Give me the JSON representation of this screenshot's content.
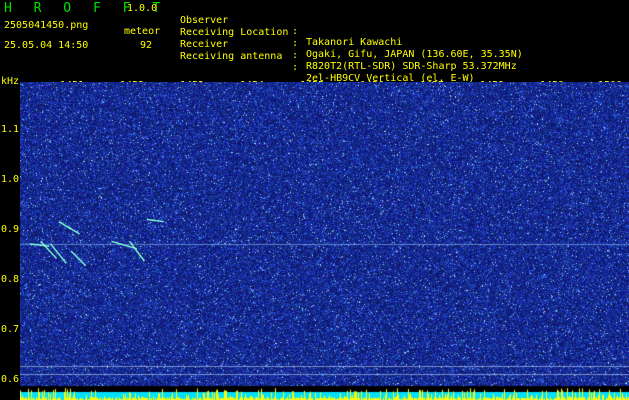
{
  "header": {
    "title": "H R O F F T",
    "version": "1.0.0",
    "file_name": "2505041450.png",
    "timestamp": "25.05.04 14:50",
    "mode": "meteor",
    "meteor_count": "92"
  },
  "metadata": [
    {
      "key": "Observer",
      "sep": ":",
      "value": "Takanori Kawachi"
    },
    {
      "key": "Receiving Location",
      "sep": ":",
      "value": "Ogaki, Gifu, JAPAN (136.60E, 35.35N)"
    },
    {
      "key": "Receiver",
      "sep": ":",
      "value": "R820T2(RTL-SDR) SDR-Sharp 53.372MHz"
    },
    {
      "key": "Receiving antenna",
      "sep": ":",
      "value": "2el-HB9CV Vertical (el. E-W)"
    }
  ],
  "axes": {
    "y_unit": "kHz",
    "x_ticks": [
      "1451",
      "1452",
      "1453",
      "1454",
      "1455",
      "1456",
      "1457",
      "1458",
      "1459",
      "1500"
    ],
    "y_ticks": [
      "1.1",
      "1.0",
      "0.9",
      "0.8",
      "0.7",
      "0.6"
    ]
  },
  "colors": {
    "background": "#000000",
    "label": "#ffff00",
    "title": "#00e000",
    "noise_dark": "#0a1466",
    "noise_bright": "#3a6ae8",
    "signal": "#7fffd0",
    "floor_cyan": "#00e0ff",
    "floor_yellow": "#ffff00"
  },
  "chart_data": {
    "type": "heatmap",
    "x_range": [
      1450,
      1500
    ],
    "y_range": [
      0.58,
      1.2
    ],
    "y_unit": "kHz",
    "carrier_line_kHz": 0.87,
    "floor_lines_kHz": [
      0.62,
      0.605
    ],
    "meteor_traces": [
      {
        "x": [
          1450.8,
          1452.4
        ],
        "y": [
          0.87,
          0.865
        ]
      },
      {
        "x": [
          1451.7,
          1453.0
        ],
        "y": [
          0.875,
          0.84
        ]
      },
      {
        "x": [
          1452.5,
          1453.8
        ],
        "y": [
          0.87,
          0.83
        ]
      },
      {
        "x": [
          1453.2,
          1454.2
        ],
        "y": [
          0.915,
          0.9
        ]
      },
      {
        "x": [
          1453.9,
          1454.9
        ],
        "y": [
          0.905,
          0.89
        ]
      },
      {
        "x": [
          1454.2,
          1455.4
        ],
        "y": [
          0.855,
          0.825
        ]
      },
      {
        "x": [
          1457.5,
          1459.6
        ],
        "y": [
          0.875,
          0.86
        ]
      },
      {
        "x": [
          1459.0,
          1460.2
        ],
        "y": [
          0.875,
          0.835
        ]
      },
      {
        "x": [
          1460.4,
          1461.8
        ],
        "y": [
          0.92,
          0.915
        ]
      }
    ]
  }
}
